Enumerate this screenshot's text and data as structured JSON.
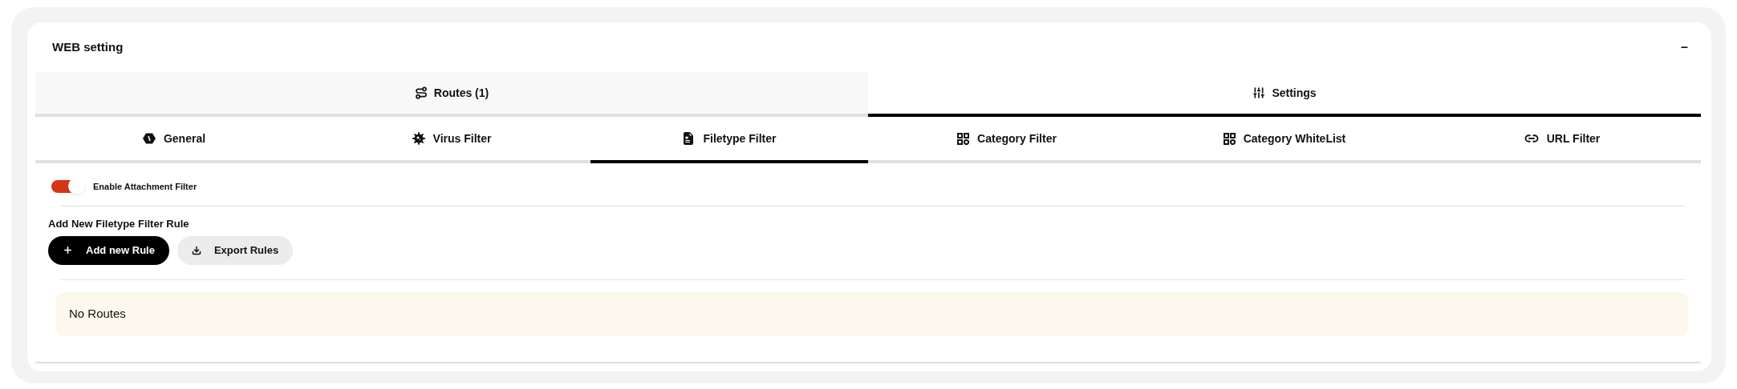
{
  "panel": {
    "title": "WEB setting",
    "collapse_symbol": "–"
  },
  "main_tabs": [
    {
      "label": "Routes (1)",
      "selected": false
    },
    {
      "label": "Settings",
      "selected": true
    }
  ],
  "sub_tabs": [
    {
      "label": "General",
      "selected": false
    },
    {
      "label": "Virus Filter",
      "selected": false
    },
    {
      "label": "Filetype Filter",
      "selected": true
    },
    {
      "label": "Category Filter",
      "selected": false
    },
    {
      "label": "Category WhiteList",
      "selected": false
    },
    {
      "label": "URL Filter",
      "selected": false
    }
  ],
  "toggle": {
    "label": "Enable Attachment Filter",
    "on": true
  },
  "section_title": "Add New Filetype Filter Rule",
  "buttons": [
    {
      "label": "Add new Rule",
      "kind": "primary"
    },
    {
      "label": "Export Rules",
      "kind": "secondary"
    }
  ],
  "notice": "No Routes"
}
